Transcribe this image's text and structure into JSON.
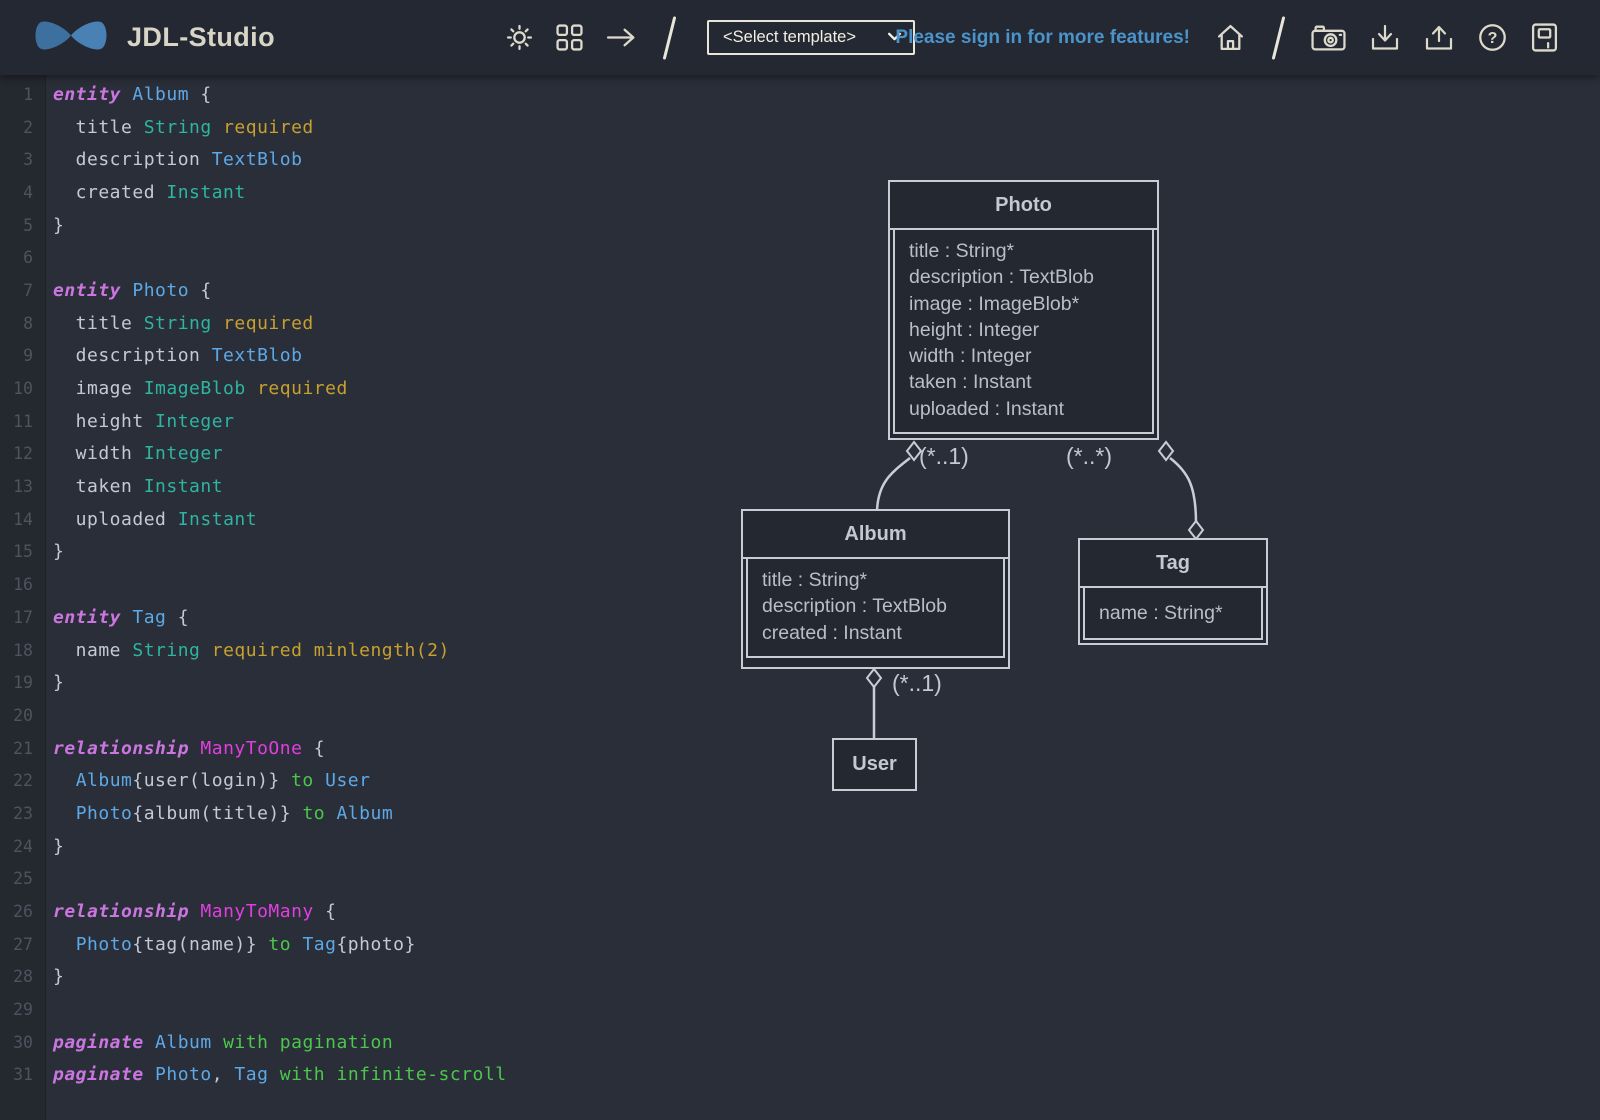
{
  "header": {
    "app_title": "JDL-Studio",
    "template_select_value": "<Select template>",
    "signin_text": "Please sign in for more features!",
    "icons": [
      "brightness-icon",
      "layout-grid-icon",
      "arrow-right-icon",
      "home-icon",
      "camera-icon",
      "download-icon",
      "upload-icon",
      "help-icon",
      "book-icon"
    ]
  },
  "palette": {
    "tokens": {
      "kw": "#cb76e0",
      "ent": "#5da9e8",
      "typ": "#2db5a1",
      "val": "#c7a02e",
      "opt": "#4bc74b",
      "rel": "#e03fe0",
      "pln": "#c3cad6"
    },
    "accent_link_blue": "#4b93c9",
    "logo_blue_left": "#3d6f9f",
    "logo_blue_right": "#4a81b4",
    "diagram_stroke": "#c9cdd5"
  },
  "editor": {
    "lines": [
      [
        {
          "t": "entity",
          "c": "kw"
        },
        {
          "t": " ",
          "c": "pln"
        },
        {
          "t": "Album",
          "c": "ent"
        },
        {
          "t": " {",
          "c": "pln"
        }
      ],
      [
        {
          "t": "  title ",
          "c": "pln"
        },
        {
          "t": "String",
          "c": "typ"
        },
        {
          "t": " ",
          "c": "pln"
        },
        {
          "t": "required",
          "c": "val"
        }
      ],
      [
        {
          "t": "  description ",
          "c": "pln"
        },
        {
          "t": "TextBlob",
          "c": "ent"
        }
      ],
      [
        {
          "t": "  created ",
          "c": "pln"
        },
        {
          "t": "Instant",
          "c": "typ"
        }
      ],
      [
        {
          "t": "}",
          "c": "pln"
        }
      ],
      [],
      [
        {
          "t": "entity",
          "c": "kw"
        },
        {
          "t": " ",
          "c": "pln"
        },
        {
          "t": "Photo",
          "c": "ent"
        },
        {
          "t": " {",
          "c": "pln"
        }
      ],
      [
        {
          "t": "  title ",
          "c": "pln"
        },
        {
          "t": "String",
          "c": "typ"
        },
        {
          "t": " ",
          "c": "pln"
        },
        {
          "t": "required",
          "c": "val"
        }
      ],
      [
        {
          "t": "  description ",
          "c": "pln"
        },
        {
          "t": "TextBlob",
          "c": "ent"
        }
      ],
      [
        {
          "t": "  image ",
          "c": "pln"
        },
        {
          "t": "ImageBlob",
          "c": "typ"
        },
        {
          "t": " ",
          "c": "pln"
        },
        {
          "t": "required",
          "c": "val"
        }
      ],
      [
        {
          "t": "  height ",
          "c": "pln"
        },
        {
          "t": "Integer",
          "c": "typ"
        }
      ],
      [
        {
          "t": "  width ",
          "c": "pln"
        },
        {
          "t": "Integer",
          "c": "typ"
        }
      ],
      [
        {
          "t": "  taken ",
          "c": "pln"
        },
        {
          "t": "Instant",
          "c": "typ"
        }
      ],
      [
        {
          "t": "  uploaded ",
          "c": "pln"
        },
        {
          "t": "Instant",
          "c": "typ"
        }
      ],
      [
        {
          "t": "}",
          "c": "pln"
        }
      ],
      [],
      [
        {
          "t": "entity",
          "c": "kw"
        },
        {
          "t": " ",
          "c": "pln"
        },
        {
          "t": "Tag",
          "c": "ent"
        },
        {
          "t": " {",
          "c": "pln"
        }
      ],
      [
        {
          "t": "  name ",
          "c": "pln"
        },
        {
          "t": "String",
          "c": "typ"
        },
        {
          "t": " ",
          "c": "pln"
        },
        {
          "t": "required",
          "c": "val"
        },
        {
          "t": " ",
          "c": "pln"
        },
        {
          "t": "minlength(2)",
          "c": "val"
        }
      ],
      [
        {
          "t": "}",
          "c": "pln"
        }
      ],
      [],
      [
        {
          "t": "relationship",
          "c": "kw"
        },
        {
          "t": " ",
          "c": "pln"
        },
        {
          "t": "ManyToOne",
          "c": "rel"
        },
        {
          "t": " {",
          "c": "pln"
        }
      ],
      [
        {
          "t": "  ",
          "c": "pln"
        },
        {
          "t": "Album",
          "c": "ent"
        },
        {
          "t": "{user(login)} ",
          "c": "pln"
        },
        {
          "t": "to",
          "c": "opt"
        },
        {
          "t": " ",
          "c": "pln"
        },
        {
          "t": "User",
          "c": "ent"
        }
      ],
      [
        {
          "t": "  ",
          "c": "pln"
        },
        {
          "t": "Photo",
          "c": "ent"
        },
        {
          "t": "{album(title)} ",
          "c": "pln"
        },
        {
          "t": "to",
          "c": "opt"
        },
        {
          "t": " ",
          "c": "pln"
        },
        {
          "t": "Album",
          "c": "ent"
        }
      ],
      [
        {
          "t": "}",
          "c": "pln"
        }
      ],
      [],
      [
        {
          "t": "relationship",
          "c": "kw"
        },
        {
          "t": " ",
          "c": "pln"
        },
        {
          "t": "ManyToMany",
          "c": "rel"
        },
        {
          "t": " {",
          "c": "pln"
        }
      ],
      [
        {
          "t": "  ",
          "c": "pln"
        },
        {
          "t": "Photo",
          "c": "ent"
        },
        {
          "t": "{tag(name)} ",
          "c": "pln"
        },
        {
          "t": "to",
          "c": "opt"
        },
        {
          "t": " ",
          "c": "pln"
        },
        {
          "t": "Tag",
          "c": "ent"
        },
        {
          "t": "{photo}",
          "c": "pln"
        }
      ],
      [
        {
          "t": "}",
          "c": "pln"
        }
      ],
      [],
      [
        {
          "t": "paginate",
          "c": "kw"
        },
        {
          "t": " ",
          "c": "pln"
        },
        {
          "t": "Album",
          "c": "ent"
        },
        {
          "t": " ",
          "c": "pln"
        },
        {
          "t": "with",
          "c": "opt"
        },
        {
          "t": " ",
          "c": "pln"
        },
        {
          "t": "pagination",
          "c": "opt"
        }
      ],
      [
        {
          "t": "paginate",
          "c": "kw"
        },
        {
          "t": " ",
          "c": "pln"
        },
        {
          "t": "Photo",
          "c": "ent"
        },
        {
          "t": ", ",
          "c": "pln"
        },
        {
          "t": "Tag",
          "c": "ent"
        },
        {
          "t": " ",
          "c": "pln"
        },
        {
          "t": "with",
          "c": "opt"
        },
        {
          "t": " ",
          "c": "pln"
        },
        {
          "t": "infinite-scroll",
          "c": "opt"
        }
      ]
    ]
  },
  "diagram": {
    "entities": [
      {
        "id": "photo",
        "name": "Photo",
        "fields": [
          "title : String*",
          "description : TextBlob",
          "image : ImageBlob*",
          "height : Integer",
          "width : Integer",
          "taken : Instant",
          "uploaded : Instant"
        ]
      },
      {
        "id": "album",
        "name": "Album",
        "fields": [
          "title : String*",
          "description : TextBlob",
          "created : Instant"
        ]
      },
      {
        "id": "tag",
        "name": "Tag",
        "fields": [
          "name : String*"
        ]
      },
      {
        "id": "user",
        "name": "User",
        "fields": []
      }
    ],
    "multiplicity": {
      "photo_album": "(*..1)",
      "photo_tag": "(*..*)",
      "album_user": "(*..1)"
    }
  }
}
